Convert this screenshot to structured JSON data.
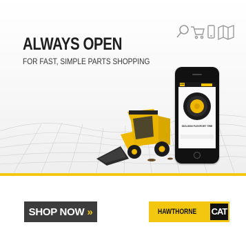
{
  "headline": "ALWAYS OPEN",
  "subheadline": "FOR FAST, SIMPLE PARTS SHOPPING",
  "icons": [
    "search-icon",
    "cart-icon",
    "mobile-icon",
    "map-icon"
  ],
  "phone_screen": {
    "logo": "CAT",
    "caption": "SKS-5000 FLEXPORT TIRE"
  },
  "cta": {
    "label": "SHOP NOW",
    "chevron": "»"
  },
  "brand": {
    "dealer": "HAWTHORNE",
    "cat": "CAT"
  },
  "colors": {
    "accent": "#f3c60f",
    "button_bg": "#3c3c3c",
    "text_dark": "#1f1f1f"
  }
}
